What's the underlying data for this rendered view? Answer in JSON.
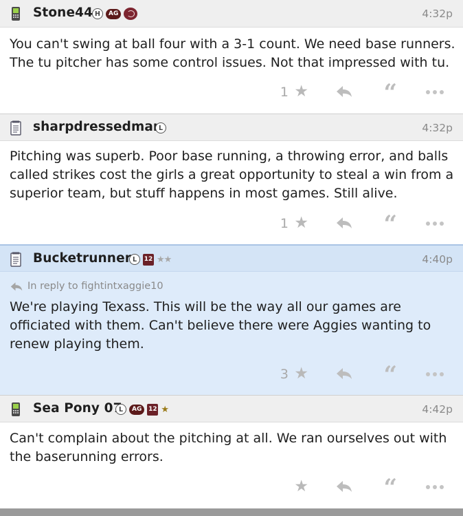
{
  "posts": [
    {
      "username": "Stone44",
      "time": "4:32p",
      "device": "phone-icon",
      "badges": {
        "h": "H",
        "ag": "AG",
        "logo": "maroon-team-logo-icon"
      },
      "text": "You can't swing at ball four with a 3-1 count. We need base runners. The tu pitcher has some control issues. Not that impressed with tu.",
      "likes": "1"
    },
    {
      "username": "sharpdressedman",
      "time": "4:32p",
      "device": "notepad-icon",
      "badges": {
        "l": "L"
      },
      "text": "Pitching was superb. Poor base running, a throwing error, and balls called strikes cost the girls a great opportunity to steal a win from a superior team, but stuff happens in most games. Still alive.",
      "likes": "1"
    },
    {
      "username": "Bucketrunner",
      "time": "4:40p",
      "device": "notepad-icon",
      "badges": {
        "l": "L",
        "twelve": "12",
        "stars": "★★"
      },
      "reply_to": "In reply to fightintxaggie10",
      "text": "We're playing Texass. This will be the way all our games are officiated with them. Can't believe there were Aggies wanting to renew playing them.",
      "likes": "3"
    },
    {
      "username": "Sea Pony 07",
      "time": "4:42p",
      "device": "phone-icon",
      "badges": {
        "l": "L",
        "ag": "AG",
        "twelve": "12",
        "stars": "★"
      },
      "text": "Can't complain about the pitching at all. We ran ourselves out with the baserunning errors.",
      "likes": ""
    }
  ],
  "icons": {
    "like": "★",
    "quote": "“",
    "reply": "reply-arrow-icon",
    "more": "more-dots-icon"
  },
  "colors": {
    "highlight": "#deebfa",
    "header": "#efefef",
    "maroon": "#5c1a1a",
    "gold_star": "#9a7a18"
  }
}
